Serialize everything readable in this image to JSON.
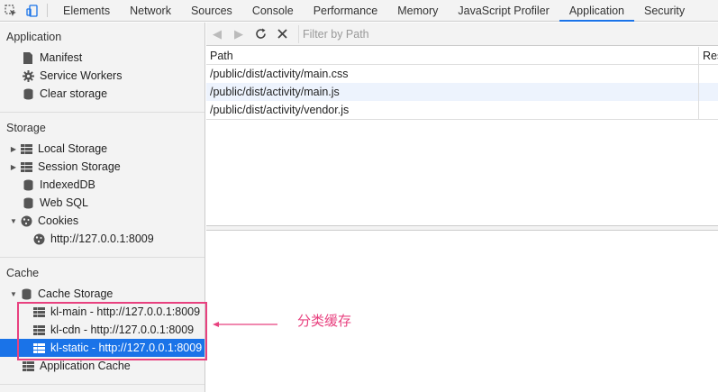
{
  "tabs": [
    {
      "label": "Elements"
    },
    {
      "label": "Network"
    },
    {
      "label": "Sources"
    },
    {
      "label": "Console"
    },
    {
      "label": "Performance"
    },
    {
      "label": "Memory"
    },
    {
      "label": "JavaScript Profiler"
    },
    {
      "label": "Application",
      "active": true
    },
    {
      "label": "Security"
    }
  ],
  "sidebar": {
    "application": {
      "title": "Application",
      "items": [
        {
          "label": "Manifest",
          "icon": "document-icon"
        },
        {
          "label": "Service Workers",
          "icon": "gear-icon"
        },
        {
          "label": "Clear storage",
          "icon": "database-icon"
        }
      ]
    },
    "storage": {
      "title": "Storage",
      "local_storage": "Local Storage",
      "session_storage": "Session Storage",
      "indexeddb": "IndexedDB",
      "websql": "Web SQL",
      "cookies": "Cookies",
      "cookie_origin": "http://127.0.0.1:8009"
    },
    "cache": {
      "title": "Cache",
      "cache_storage": "Cache Storage",
      "entries": [
        {
          "label": "kl-main - http://127.0.0.1:8009"
        },
        {
          "label": "kl-cdn - http://127.0.0.1:8009"
        },
        {
          "label": "kl-static - http://127.0.0.1:8009",
          "selected": true
        }
      ],
      "app_cache": "Application Cache"
    }
  },
  "toolbar": {
    "filter_placeholder": "Filter by Path"
  },
  "table": {
    "columns": [
      "Path",
      "Res"
    ],
    "rows": [
      {
        "path": "/public/dist/activity/main.css"
      },
      {
        "path": "/public/dist/activity/main.js"
      },
      {
        "path": "/public/dist/activity/vendor.js"
      }
    ]
  },
  "annotation": {
    "text": "分类缓存",
    "color": "#e8417f"
  },
  "colors": {
    "accent": "#1a73e8",
    "selected_bg": "#1a73e8",
    "row_alt": "#edf3fd"
  }
}
